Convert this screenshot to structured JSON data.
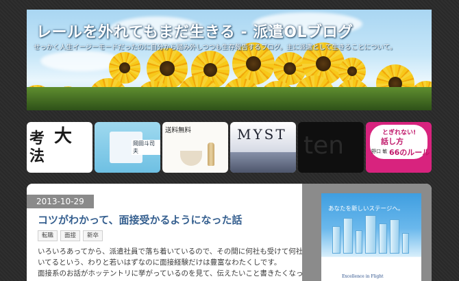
{
  "header": {
    "title": "レールを外れてもまだ生きる - 派遣OLブログ",
    "description": "せっかく人生イージーモードだったのに自分から踏み外しつつも生存報告するブログ。主に派遣として生きることについて。"
  },
  "thumbnails": [
    {
      "name": "book-cover-kangaehou",
      "text_a": "大",
      "text_b": "考",
      "text_c": "法"
    },
    {
      "name": "book-cover-okada",
      "author": "岡田斗司夫"
    },
    {
      "name": "product-matcha-set",
      "label": "送料無料"
    },
    {
      "name": "game-myst",
      "label": "MYST"
    },
    {
      "name": "dark-thumbnail",
      "label": "ten"
    },
    {
      "name": "book-cover-hanashikata",
      "line1": "とぎれない!",
      "line2": "話し方",
      "line3": "66のルール",
      "author": "野口 敏"
    }
  ],
  "post": {
    "date": "2013-10-29",
    "title": "コツがわかって、面接受かるようになった話",
    "tags": [
      "転職",
      "面接",
      "新卒"
    ],
    "paragraphs": [
      "いろいろあってから、派遣社員で落ち着いているので、その間に何社も受けて何社かで働",
      "いてるという、わりと若いはずなのに面接経験だけは豊富なわたくしです。",
      "面接系のお話がホッテントリに挙がっているのを見て、伝えたいこと書きたくなったで"
    ]
  },
  "sidebar_ad": {
    "headline": "あなたを新しいステージへ。",
    "footer": "Excellence in Flight"
  },
  "colors": {
    "background": "#2c2c2c",
    "post_title": "#355f8f",
    "date_tab": "#8a8a8a",
    "sidebar": "#8b8b8b"
  }
}
